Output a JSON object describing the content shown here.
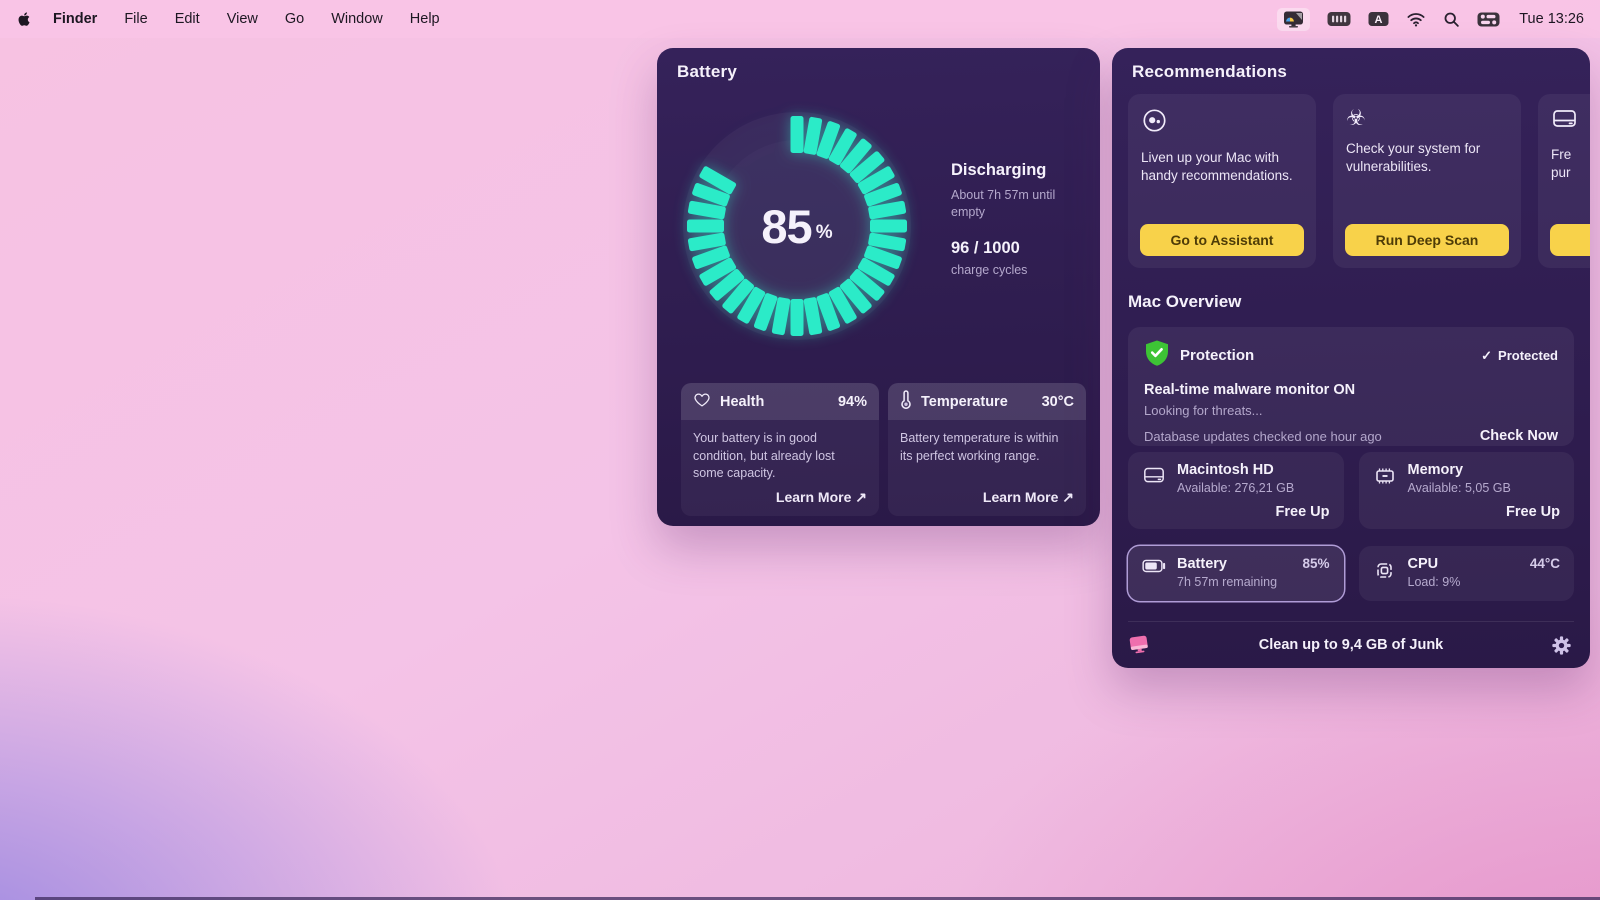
{
  "menubar": {
    "app_name": "Finder",
    "menus": [
      "File",
      "Edit",
      "View",
      "Go",
      "Window",
      "Help"
    ],
    "clock": "Tue 13:26"
  },
  "battery_panel": {
    "title": "Battery",
    "gauge": {
      "percent": 85,
      "unit": "%",
      "segments_total": 36,
      "color": "#2BEBC8"
    },
    "status": {
      "state": "Discharging",
      "detail": "About 7h 57m until empty",
      "cycles": "96 / 1000",
      "cycles_label": "charge cycles"
    },
    "health": {
      "title": "Health",
      "value": "94%",
      "body": "Your battery is in good condition, but already lost some capacity.",
      "link": "Learn More ↗"
    },
    "temperature": {
      "title": "Temperature",
      "value": "30°C",
      "body": "Battery temperature is within its perfect working range.",
      "link": "Learn More ↗"
    }
  },
  "recommendations": {
    "title": "Recommendations",
    "cards": [
      {
        "icon": "assistant-icon",
        "text": "Liven up your Mac with handy recommendations.",
        "button": "Go to Assistant"
      },
      {
        "icon": "biohazard-icon",
        "text": "Check your system for vulnerabilities.",
        "button": "Run Deep Scan"
      },
      {
        "icon": "drive-icon",
        "text_line1": "Fre",
        "text_line2": "pur",
        "button": ""
      }
    ]
  },
  "mac_overview": {
    "title": "Mac Overview",
    "protection": {
      "title": "Protection",
      "check": "✓",
      "badge": "Protected",
      "line1": "Real-time malware monitor ON",
      "line2": "Looking for threats...",
      "footer": "Database updates checked one hour ago",
      "action": "Check Now"
    },
    "stats": {
      "disk": {
        "title": "Macintosh HD",
        "subtitle": "Available: 276,21 GB",
        "action": "Free Up"
      },
      "memory": {
        "title": "Memory",
        "subtitle": "Available: 5,05 GB",
        "action": "Free Up"
      },
      "battery": {
        "title": "Battery",
        "subtitle": "7h 57m remaining",
        "value": "85%",
        "highlighted": true
      },
      "cpu": {
        "title": "CPU",
        "subtitle": "Load: 9%",
        "value": "44°C"
      }
    },
    "footer": {
      "label": "Clean up to 9,4 GB of Junk"
    }
  },
  "colors": {
    "accent_teal": "#2BEBC8",
    "accent_yellow": "#F8D24A",
    "protect_green": "#3DC435"
  }
}
